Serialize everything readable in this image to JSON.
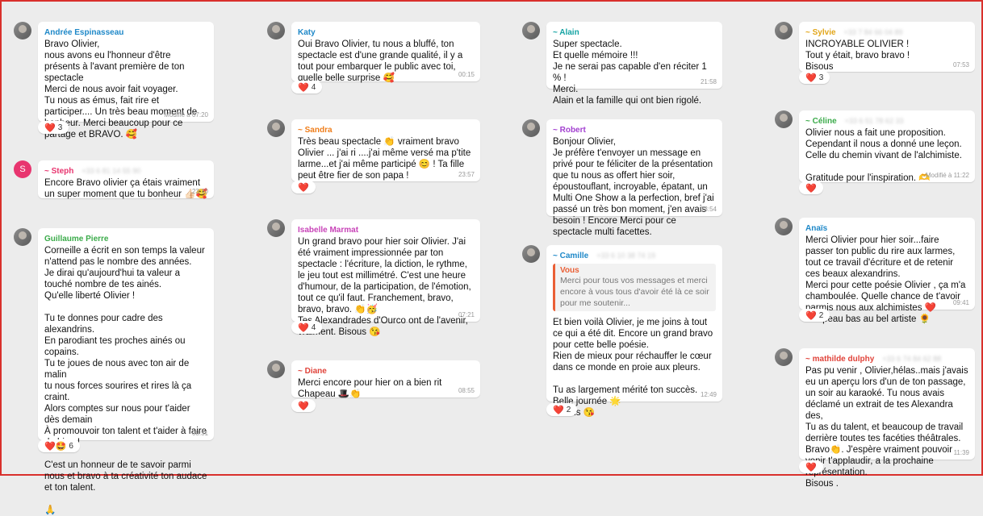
{
  "messages": [
    {
      "id": "andree",
      "name": "Andrée Espinasseau",
      "name_color": "#1e88c8",
      "phone": "",
      "avatar": "photo",
      "text": "Bravo Olivier,\nnous avons eu l'honneur d'être présents à l'avant première de ton spectacle\n Merci  de nous avoir fait voyager.\nTu nous as émus, fait rire et participer.... Un très beau moment de bonheur. Merci beaucoup pour ce partage et BRAVO. 🥰",
      "meta": "Modifié à 07:20",
      "reaction": "❤️",
      "count": "3"
    },
    {
      "id": "steph",
      "name": "~ Steph",
      "name_color": "#e8356f",
      "phone": "+33 6 81 14 55 90",
      "avatar": "letter",
      "avatar_letter": "S",
      "text": "Encore Bravo olivier ça étais vraiment un super moment que tu bonheur 👍🏻🥰",
      "meta": "23:10",
      "reaction": "",
      "count": ""
    },
    {
      "id": "guillaume",
      "name": "Guillaume Pierre",
      "name_color": "#3bab4a",
      "phone": "",
      "avatar": "photo",
      "text": "Corneille a écrit en son temps la valeur n'attend pas le nombre des années.\nJe dirai qu'aujourd'hui ta valeur a touché nombre de tes ainés.\nQu'elle liberté Olivier !\n\nTu te donnes pour cadre des alexandrins.\nEn  parodiant tes proches ainés ou copains.\nTu te joues de nous avec ton air de malin\ntu nous forces sourires et rires là ça craint.\nAlors comptes sur nous pour t'aider dès demain\nÀ promouvoir ton talent et t'aider à faire du bien !\n\nC'est un honneur de te savoir parmi nous et bravo à ta créativité ton audace et ton talent.\n\n🙏",
      "meta": "08:31",
      "reaction": "❤️🤩",
      "count": "6"
    },
    {
      "id": "katy",
      "name": "Katy",
      "name_color": "#1e88c8",
      "phone": "",
      "avatar": "photo",
      "text": "Oui Bravo Olivier, tu nous a bluffé, ton spectacle est d'une grande qualité, il y a tout pour embarquer le public avec toi, quelle belle surprise 🥰",
      "meta": "00:15",
      "reaction": "❤️",
      "count": "4"
    },
    {
      "id": "sandra",
      "name": "~ Sandra",
      "name_color": "#ef7d1a",
      "phone": "",
      "avatar": "photo",
      "text": "Très beau spectacle 👏 vraiment bravo Olivier ... j'ai ri ....j'ai même versé ma p'tite larme...et j'ai même participé 😊 ! Ta fille peut être fier de son papa !",
      "meta": "23:57",
      "reaction": "❤️",
      "count": ""
    },
    {
      "id": "isabelle",
      "name": "Isabelle Marmat",
      "name_color": "#c843b8",
      "phone": "",
      "avatar": "photo",
      "text": "Un grand bravo pour hier soir Olivier. J'ai été vraiment impressionnée par ton spectacle : l'écriture, la diction, le rythme, le jeu tout est millimétré. C'est une heure d'humour, de la participation, de l'émotion, tout ce qu'il faut. Franchement, bravo, bravo, bravo. 👏🥳\nTes Alexandrades d'Ourco ont de l'avenir, vraiment. Bisous 😘",
      "meta": "07:21",
      "reaction": "❤️",
      "count": "4"
    },
    {
      "id": "diane",
      "name": "~ Diane",
      "name_color": "#e0433a",
      "phone": "",
      "avatar": "photo",
      "text": "Merci encore pour hier on a bien rit Chapeau 🎩👏",
      "meta": "08:55",
      "reaction": "❤️",
      "count": ""
    },
    {
      "id": "alain",
      "name": "~ Alain",
      "name_color": "#14a3a3",
      "phone": "",
      "avatar": "photo",
      "text": "Super spectacle.\nEt quelle mémoire !!!\nJe ne serai pas capable d'en réciter 1 % !\nMerci.\nAlain et la famille qui ont bien rigolé.",
      "meta": "21:58",
      "reaction": "",
      "count": ""
    },
    {
      "id": "robert",
      "name": "~ Robert",
      "name_color": "#a23fd0",
      "phone": "",
      "avatar": "photo",
      "text": "Bonjour Olivier,\nJe préfère t'envoyer un message en privé pour te féliciter de la présentation que tu nous as offert hier soir, époustouflant, incroyable, épatant, un Multi One Show a la perfection, bref j'ai passé un très bon moment, j'en avais besoin ! Encore Merci pour ce spectacle multi facettes.",
      "meta": "13:54",
      "reaction": "",
      "count": ""
    },
    {
      "id": "camille",
      "name": "~ Camille",
      "name_color": "#1e88c8",
      "phone": "+33 6 10 38 74 19",
      "avatar": "photo",
      "quote_name": "Vous",
      "quote_text": "Merci pour tous vos messages et merci encore à vous tous d'avoir été là ce soir pour me soutenir...",
      "text": "Et bien voilà Olivier, je me joins à tout ce qui a été dit. Encore un grand bravo pour cette belle poésie.\nRien de mieux pour réchauffer le cœur dans ce monde en proie aux pleurs.\n\nTu as largement mérité ton succès.\nBelle journée 🌟\nBisous 😘",
      "meta": "12:49",
      "reaction": "❤️",
      "count": "2"
    },
    {
      "id": "sylvie",
      "name": "~ Sylvie",
      "name_color": "#e2a61a",
      "phone": "+33 7 84 66 04 89",
      "avatar": "photo",
      "text": "INCROYABLE OLIVIER !\nTout y était, bravo bravo !\nBisous",
      "meta": "07:53",
      "reaction": "❤️",
      "count": "3"
    },
    {
      "id": "celine",
      "name": "~ Céline",
      "name_color": "#3bab4a",
      "phone": "+33 6 51 78 62 33",
      "avatar": "photo",
      "text": "Olivier nous a fait une proposition.\nCependant il nous a donné une leçon.\nCelle du chemin vivant de l'alchimiste.\n\nGratitude pour l'inspiration. 🫶",
      "meta": "Modifié à 11:22",
      "reaction": "❤️",
      "count": ""
    },
    {
      "id": "anais",
      "name": "Anaïs",
      "name_color": "#1e88c8",
      "phone": "",
      "avatar": "photo",
      "text": "Merci Olivier pour hier soir...faire passer ton public du rire aux larmes, tout ce travail d'écriture et de retenir ces beaux alexandrins.\nMerci pour cette poésie Olivier , ça m'a chamboulée. Quelle chance de t'avoir parmis nous aux alchimistes ❤️\nChapeau bas au bel artiste 🌻",
      "meta": "09:41",
      "reaction": "❤️",
      "count": "2"
    },
    {
      "id": "mathilde",
      "name": "~ mathilde dulphy",
      "name_color": "#e0433a",
      "phone": "+33 6 74 84 62 88",
      "avatar": "photo",
      "text": "Pas pu venir , Olivier,hélas..mais j'avais eu un aperçu lors d'un de ton passage, un soir au karaoké. Tu nous avais déclamé un extrait de tes Alexandra des,\nTu as du talent, et beaucoup de travail derrière toutes tes facéties théâtrales.\nBravo👏. J'espère vraiment pouvoir venir t'applaudir, a la prochaine représentation.\nBisous .",
      "meta": "11:39",
      "reaction": "❤️",
      "count": ""
    }
  ]
}
